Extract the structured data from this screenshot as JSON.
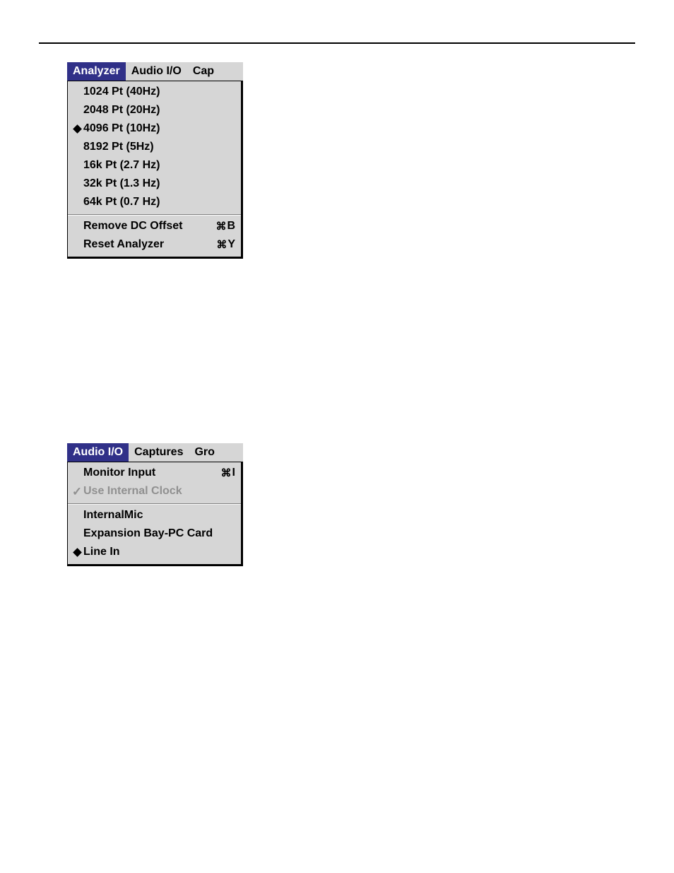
{
  "analyzer_menu": {
    "menubar": [
      {
        "label": "Analyzer",
        "active": true
      },
      {
        "label": "Audio I/O",
        "active": false
      },
      {
        "label": "Cap",
        "active": false
      }
    ],
    "section1": [
      {
        "label": "1024 Pt (40Hz)",
        "mark": ""
      },
      {
        "label": "2048 Pt (20Hz)",
        "mark": ""
      },
      {
        "label": "4096 Pt (10Hz)",
        "mark": "diamond"
      },
      {
        "label": "8192 Pt (5Hz)",
        "mark": ""
      },
      {
        "label": "16k  Pt (2.7 Hz)",
        "mark": ""
      },
      {
        "label": "32k  Pt (1.3 Hz)",
        "mark": ""
      },
      {
        "label": "64k  Pt (0.7 Hz)",
        "mark": ""
      }
    ],
    "section2": [
      {
        "label": "Remove DC Offset",
        "shortcut": "B"
      },
      {
        "label": "Reset Analyzer",
        "shortcut": "Y"
      }
    ]
  },
  "audio_menu": {
    "menubar": [
      {
        "label": "Audio I/O",
        "active": true
      },
      {
        "label": "Captures",
        "active": false
      },
      {
        "label": "Gro",
        "active": false
      }
    ],
    "section1": [
      {
        "label": "Monitor Input",
        "shortcut": "I",
        "mark": "",
        "disabled": false
      },
      {
        "label": "Use Internal Clock",
        "shortcut": "",
        "mark": "check",
        "disabled": true
      }
    ],
    "section2": [
      {
        "label": "InternalMic",
        "mark": ""
      },
      {
        "label": "Expansion Bay-PC Card",
        "mark": ""
      },
      {
        "label": "Line In",
        "mark": "diamond"
      }
    ]
  },
  "cmd_glyph": "⌘"
}
